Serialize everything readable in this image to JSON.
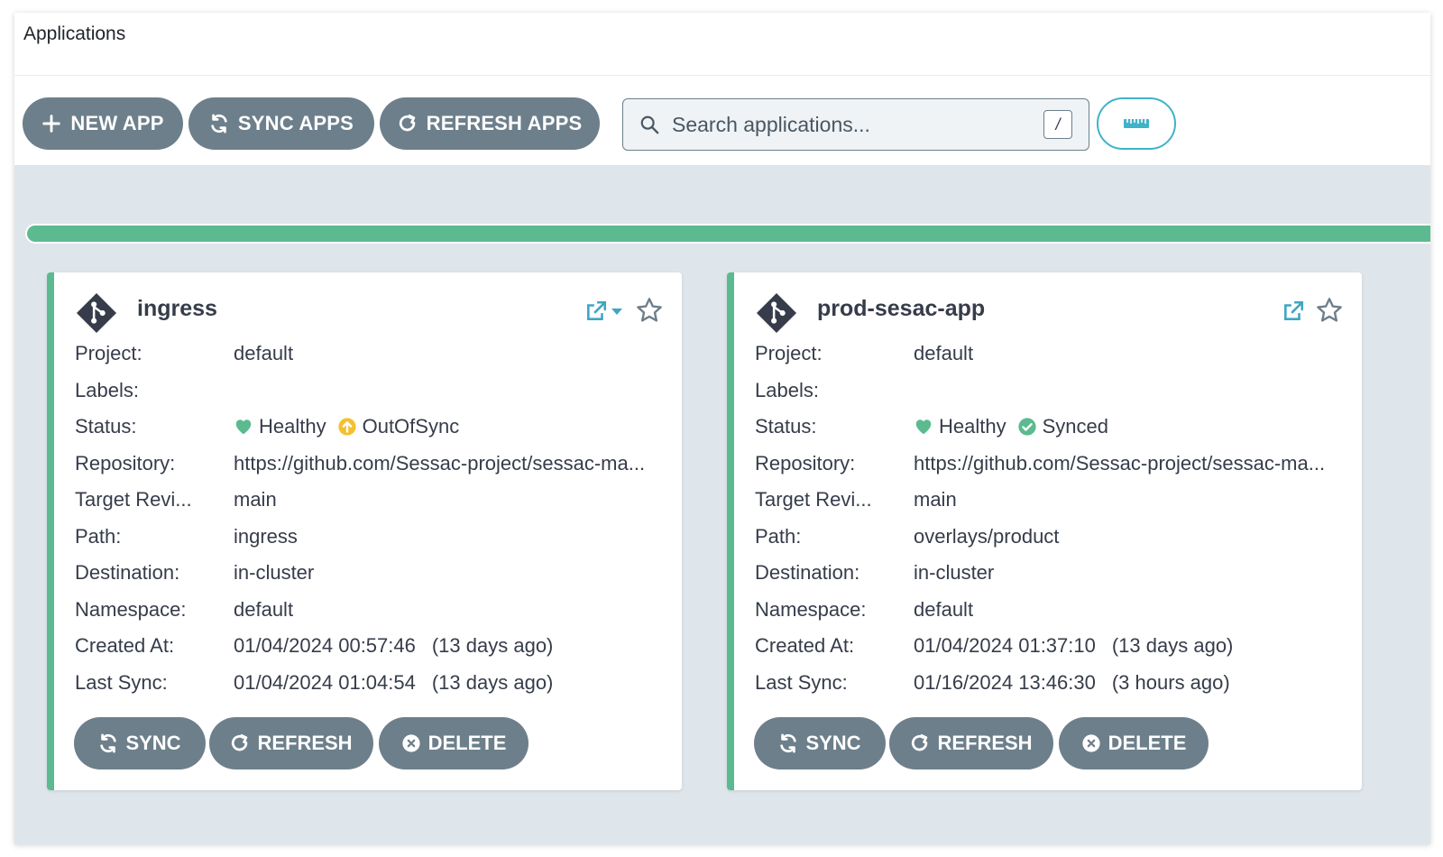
{
  "colors": {
    "accent_green": "#5bba90",
    "button_gray": "#6d7f8b",
    "out_of_sync": "#f4c030",
    "teal_outline": "#3fb3c8",
    "background": "#dee6eb"
  },
  "window": {
    "title": "Applications"
  },
  "toolbar": {
    "new_app_label": "NEW APP",
    "new_app_icon": "plus-icon",
    "sync_apps_label": "SYNC APPS",
    "sync_apps_icon": "sync-icon",
    "refresh_apps_label": "REFRESH APPS",
    "refresh_apps_icon": "refresh-icon",
    "search_placeholder": "Search applications...",
    "search_shortcut": "/",
    "ruler_icon": "ruler-icon"
  },
  "sync_progress": {
    "synced_fraction": 1.0
  },
  "labels": {
    "project": "Project:",
    "labels": "Labels:",
    "status": "Status:",
    "repository": "Repository:",
    "target_revision": "Target Revi...",
    "path": "Path:",
    "destination": "Destination:",
    "namespace": "Namespace:",
    "created_at": "Created At:",
    "last_sync": "Last Sync:"
  },
  "actions": {
    "sync": "SYNC",
    "refresh": "REFRESH",
    "delete": "DELETE"
  },
  "apps": [
    {
      "name": "ingress",
      "project": "default",
      "labels": "",
      "health": "Healthy",
      "sync_status": "OutOfSync",
      "sync_icon": "out-of-sync-arrow-icon",
      "repository": "https://github.com/Sessac-project/sessac-ma...",
      "target_revision": "main",
      "path": "ingress",
      "destination": "in-cluster",
      "namespace": "default",
      "created_at": "01/04/2024 00:57:46",
      "created_ago": "(13 days ago)",
      "last_sync": "01/04/2024 01:04:54",
      "last_sync_ago": "(13 days ago)",
      "has_link_dropdown": true
    },
    {
      "name": "prod-sesac-app",
      "project": "default",
      "labels": "",
      "health": "Healthy",
      "sync_status": "Synced",
      "sync_icon": "synced-check-icon",
      "repository": "https://github.com/Sessac-project/sessac-ma...",
      "target_revision": "main",
      "path": "overlays/product",
      "destination": "in-cluster",
      "namespace": "default",
      "created_at": "01/04/2024 01:37:10",
      "created_ago": "(13 days ago)",
      "last_sync": "01/16/2024 13:46:30",
      "last_sync_ago": "(3 hours ago)",
      "has_link_dropdown": false
    }
  ]
}
